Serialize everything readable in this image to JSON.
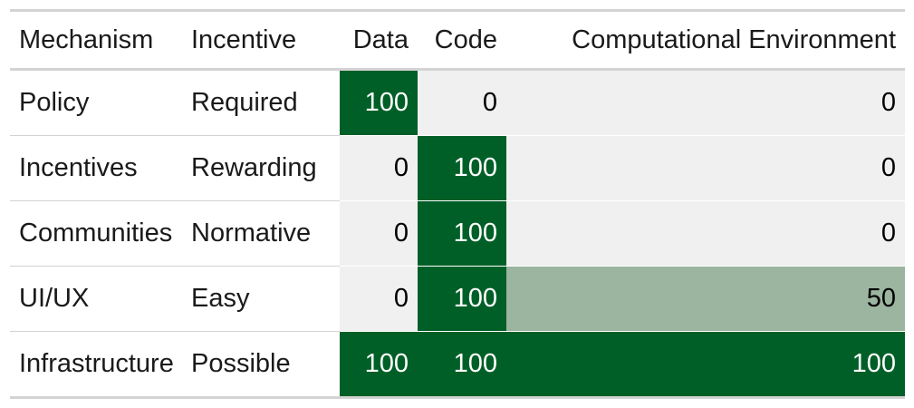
{
  "table": {
    "headers": [
      "Mechanism",
      "Incentive",
      "Data",
      "Code",
      "Computational Environment"
    ],
    "rows": [
      {
        "mechanism": "Policy",
        "incentive": "Required",
        "data": 100,
        "code": 0,
        "env": 0
      },
      {
        "mechanism": "Incentives",
        "incentive": "Rewarding",
        "data": 0,
        "code": 100,
        "env": 0
      },
      {
        "mechanism": "Communities",
        "incentive": "Normative",
        "data": 0,
        "code": 100,
        "env": 0
      },
      {
        "mechanism": "UI/UX",
        "incentive": "Easy",
        "data": 0,
        "code": 100,
        "env": 50
      },
      {
        "mechanism": "Infrastructure",
        "incentive": "Possible",
        "data": 100,
        "code": 100,
        "env": 100
      }
    ]
  },
  "colors": {
    "high": "#005f27",
    "mid": "#9bb5a0",
    "low": "#f0f0f0",
    "text_dark": "#000000",
    "text_light": "#ffffff",
    "rule": "#d3d3d3"
  }
}
